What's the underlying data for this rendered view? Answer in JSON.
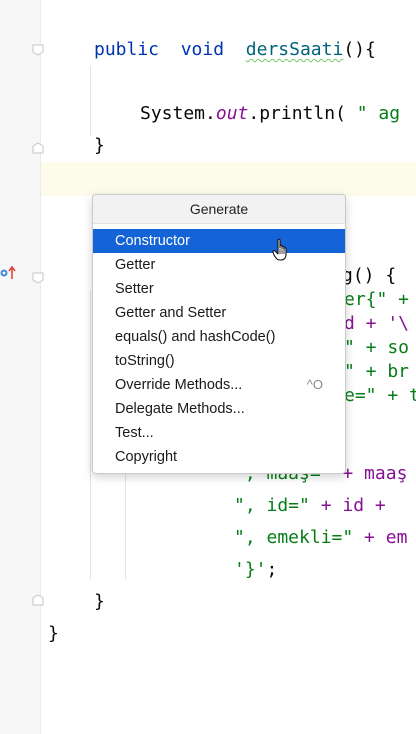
{
  "editor": {
    "lines": [
      {
        "kw1": "public",
        "kw2": "void",
        "method": "dersSaati",
        "rest": "(){"
      },
      {
        "pre": "System.",
        "it": "out",
        "mid": ".println( ",
        "str": "\" ag"
      },
      {
        "text": "}"
      },
      {
        "sig": "g() {"
      },
      {
        "pre": "er{\" +"
      },
      {
        "pre": "d + '\\"
      },
      {
        "pre": "\" + so"
      },
      {
        "pre": "\" + br"
      },
      {
        "pre": "e=\" + t"
      },
      {
        "str": "', maaş=\"",
        "rest": " + maaş"
      },
      {
        "str": "\", id=\"",
        "rest": " + id +"
      },
      {
        "str": "\", emekli=\"",
        "rest": " + em"
      },
      {
        "str": "'}'",
        "rest": ";"
      },
      {
        "text": "}"
      },
      {
        "text": "}"
      }
    ]
  },
  "popup": {
    "title": "Generate",
    "items": [
      {
        "label": "Constructor",
        "selected": true,
        "shortcut": ""
      },
      {
        "label": "Getter",
        "selected": false,
        "shortcut": ""
      },
      {
        "label": "Setter",
        "selected": false,
        "shortcut": ""
      },
      {
        "label": "Getter and Setter",
        "selected": false,
        "shortcut": ""
      },
      {
        "label": "equals() and hashCode()",
        "selected": false,
        "shortcut": ""
      },
      {
        "label": "toString()",
        "selected": false,
        "shortcut": ""
      },
      {
        "label": "Override Methods...",
        "selected": false,
        "shortcut": "^O"
      },
      {
        "label": "Delegate Methods...",
        "selected": false,
        "shortcut": ""
      },
      {
        "label": "Test...",
        "selected": false,
        "shortcut": ""
      },
      {
        "label": "Copyright",
        "selected": false,
        "shortcut": ""
      }
    ]
  },
  "colors": {
    "selection": "#1464d7",
    "keyword": "#0033b3",
    "string": "#067d17",
    "field": "#871094"
  },
  "icons": [
    "fold-marker-icon",
    "override-method-icon",
    "hand-pointer-icon"
  ]
}
